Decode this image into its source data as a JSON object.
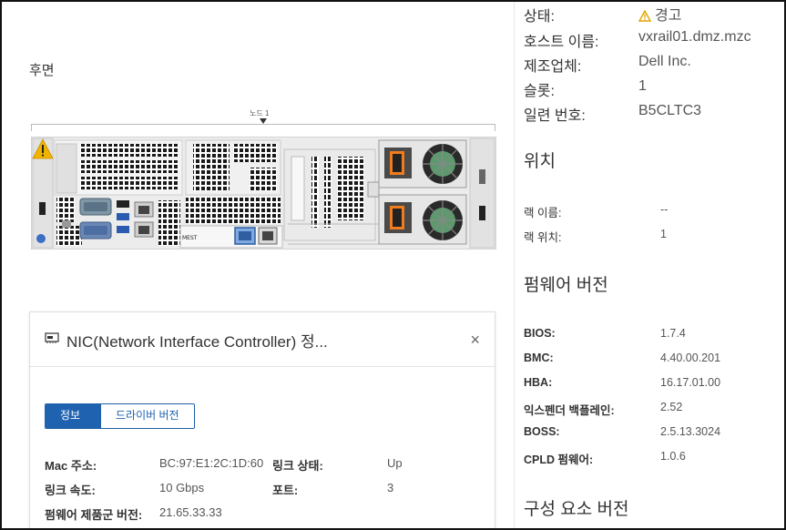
{
  "rear": {
    "title": "후면",
    "node_label": "노드 1"
  },
  "server": {
    "port_label": "MEST",
    "status_icon": "warning-icon"
  },
  "nic_panel": {
    "title": "NIC(Network Interface Controller) 정...",
    "close_glyph": "×",
    "tabs": [
      {
        "label": "정보",
        "active": true
      },
      {
        "label": "드라이버 버전",
        "active": false
      }
    ],
    "fields": {
      "mac_label": "Mac 주소:",
      "mac_value": "BC:97:E1:2C:1D:60",
      "link_status_label": "링크 상태:",
      "link_status_value": "Up",
      "link_speed_label": "링크 속도:",
      "link_speed_value": "10 Gbps",
      "port_label": "포트:",
      "port_value": "3",
      "fw_family_label": "펌웨어 제품군 버전:",
      "fw_family_value": "21.65.33.33"
    }
  },
  "details": {
    "status_label": "상태:",
    "status_value": "경고",
    "host_label": "호스트 이름:",
    "host_value": "vxrail01.dmz.mzc",
    "manufacturer_label": "제조업체:",
    "manufacturer_value": "Dell Inc.",
    "slot_label": "슬롯:",
    "slot_value": "1",
    "serial_label": "일련 번호:",
    "serial_value": "B5CLTC3"
  },
  "location": {
    "title": "위치",
    "rack_name_label": "랙 이름:",
    "rack_name_value": "--",
    "rack_position_label": "랙 위치:",
    "rack_position_value": "1"
  },
  "firmware": {
    "title": "펌웨어 버전",
    "items": [
      {
        "label": "BIOS:",
        "value": "1.7.4"
      },
      {
        "label": "BMC:",
        "value": "4.40.00.201"
      },
      {
        "label": "HBA:",
        "value": "16.17.01.00"
      },
      {
        "label": "익스펜더 백플레인:",
        "value": "2.52"
      },
      {
        "label": "BOSS:",
        "value": "2.5.13.3024"
      },
      {
        "label": "CPLD 펌웨어:",
        "value": "1.0.6"
      }
    ]
  },
  "components": {
    "title": "구성 요소 버전"
  },
  "colors": {
    "accent": "#1f63b0",
    "warning": "#f0b400",
    "psu_orange": "#f07c1e",
    "fan_green": "#5c9a6e",
    "port_blue": "#3a7bd5"
  }
}
